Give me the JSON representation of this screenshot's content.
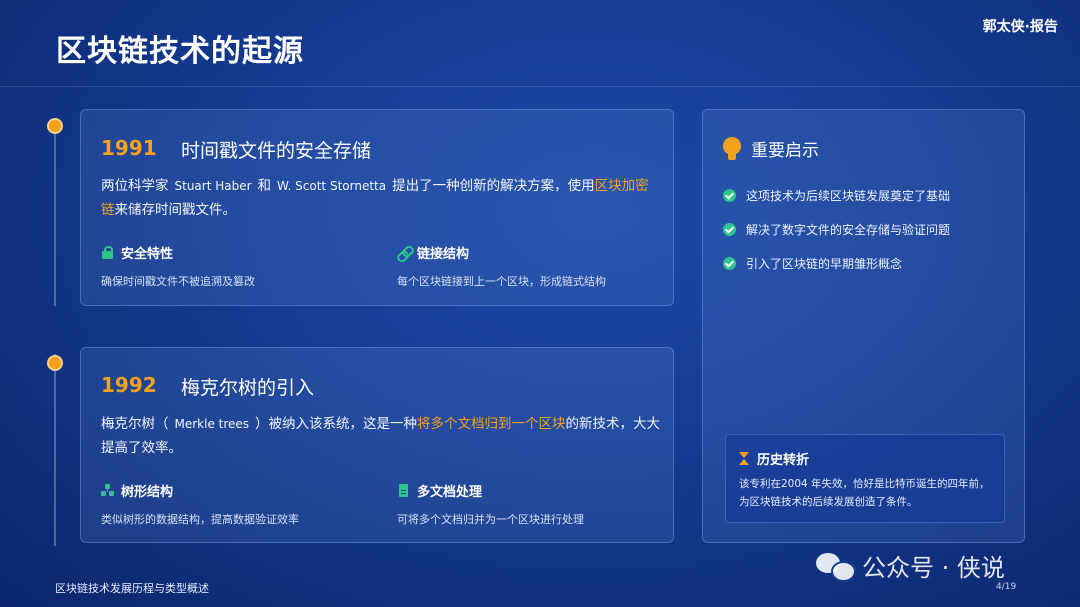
{
  "header": {
    "title": "区块链技术的起源",
    "brand": "郭太侠·报告"
  },
  "timeline": [
    {
      "year": "1991",
      "title": "时间戳文件的安全存储",
      "body": {
        "p1": "两位科学家",
        "en1": "Stuart Haber",
        "p2": "和",
        "en2": "W. Scott Stornetta",
        "p3": "提出了一种创新的解决方案，使用",
        "hl": "区块加密链",
        "p4": "来储存时间戳文件。"
      },
      "features": [
        {
          "icon": "lock-icon",
          "title": "安全特性",
          "desc": "确保时间戳文件不被追溯及篡改"
        },
        {
          "icon": "link-icon",
          "title": "链接结构",
          "desc": "每个区块链接到上一个区块，形成链式结构"
        }
      ]
    },
    {
      "year": "1992",
      "title": "梅克尔树的引入",
      "body": {
        "p1": "梅克尔树（",
        "en1": "Merkle trees",
        "p2": "）被纳入该系统，这是一种",
        "hl": "将多个文档归到一个区块",
        "p3": "的新技术，大大提高了效率。"
      },
      "features": [
        {
          "icon": "tree-icon",
          "title": "树形结构",
          "desc": "类似树形的数据结构，提高数据验证效率"
        },
        {
          "icon": "file-icon",
          "title": "多文档处理",
          "desc": "可将多个文档归并为一个区块进行处理"
        }
      ]
    }
  ],
  "sidebar": {
    "icon": "bulb-icon",
    "title": "重要启示",
    "tips": [
      "这项技术为后续区块链发展奠定了基础",
      "解决了数字文件的安全存储与验证问题",
      "引入了区块链的早期雏形概念"
    ],
    "history": {
      "icon": "hourglass-icon",
      "title": "历史转折",
      "text": "该专利在2004 年失效，恰好是比特币诞生的四年前，为区块链技术的后续发展创造了条件。"
    }
  },
  "footer": {
    "left": "区块链技术发展历程与类型概述",
    "page": "4/19"
  },
  "watermark": {
    "icon": "wechat-icon",
    "text": "公众号 · 侠说"
  },
  "colors": {
    "accent": "#f4a11e",
    "green": "#2ec58d",
    "background": "#153d93"
  }
}
